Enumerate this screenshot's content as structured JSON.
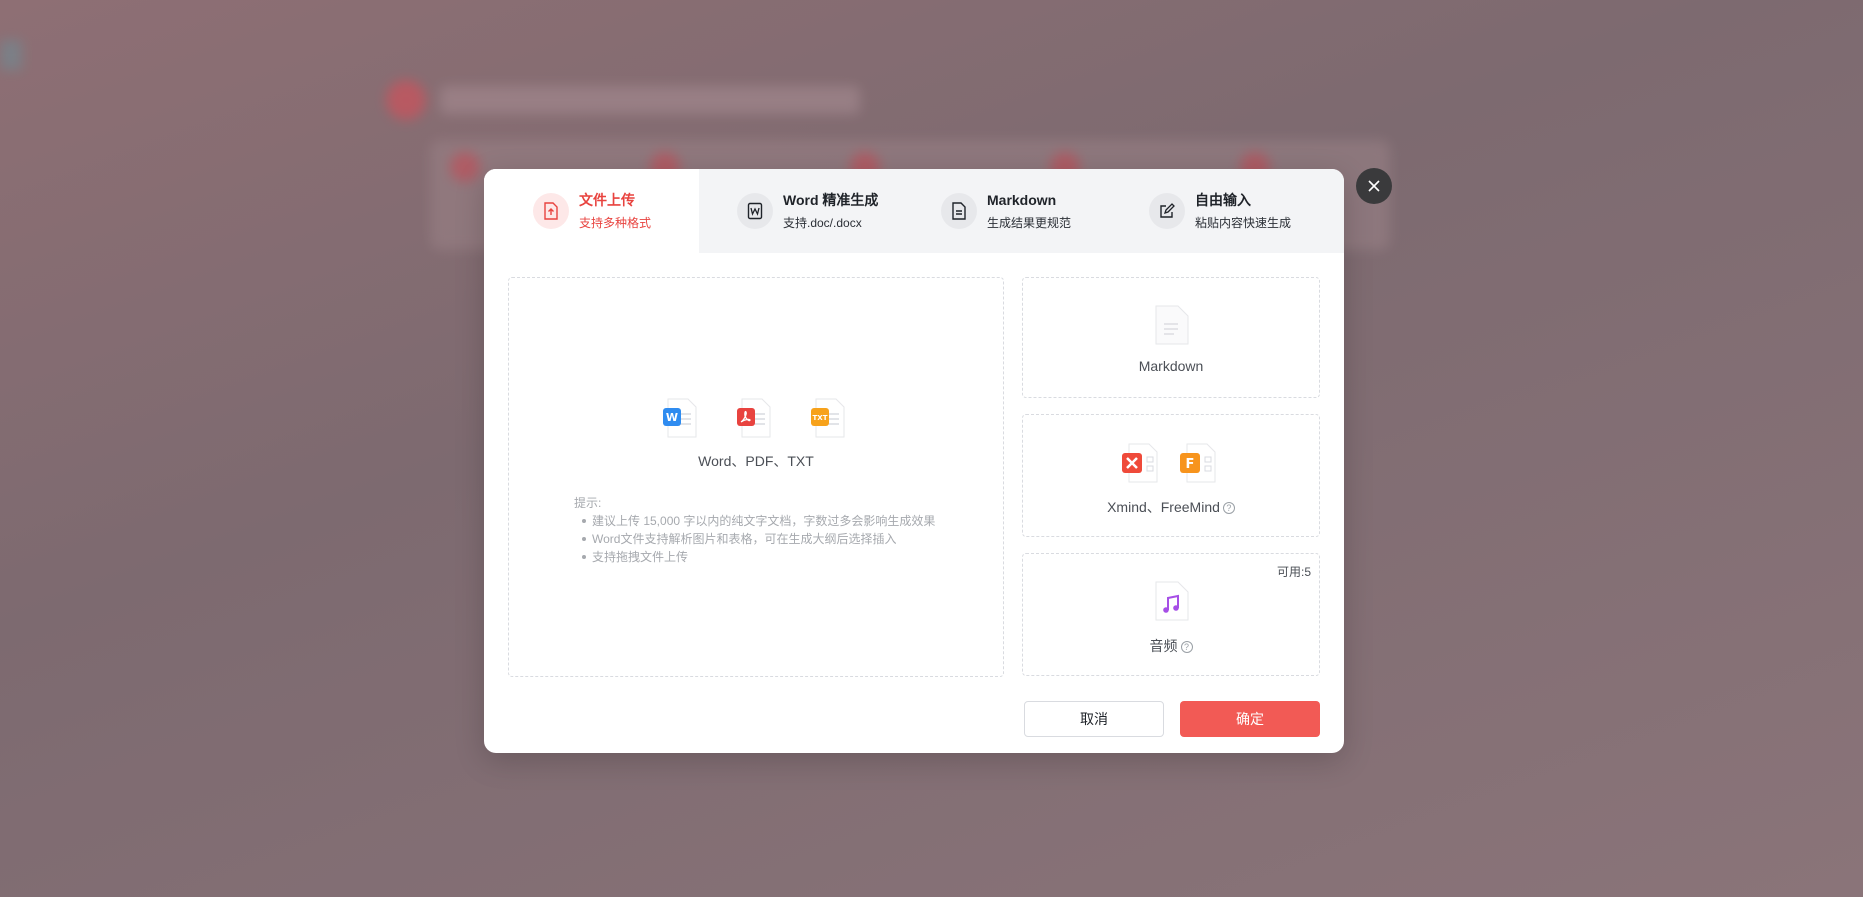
{
  "tabs": [
    {
      "title": "文件上传",
      "subtitle": "支持多种格式",
      "icon": "upload-file-icon",
      "active": true
    },
    {
      "title": "Word 精准生成",
      "subtitle": "支持.doc/.docx",
      "icon": "word-doc-icon",
      "active": false
    },
    {
      "title": "Markdown",
      "subtitle": "生成结果更规范",
      "icon": "document-lines-icon",
      "active": false
    },
    {
      "title": "自由输入",
      "subtitle": "粘贴内容快速生成",
      "icon": "edit-icon",
      "active": false
    }
  ],
  "upload": {
    "icons": [
      {
        "name": "word-file-icon",
        "badge": "W",
        "color": "#2f8cf0"
      },
      {
        "name": "pdf-file-icon",
        "badge": "PDF",
        "color": "#e8433f"
      },
      {
        "name": "txt-file-icon",
        "badge": "TXT",
        "color": "#f7a21b"
      }
    ],
    "formats": "Word、PDF、TXT",
    "tips_title": "提示:",
    "tips": [
      "建议上传 15,000 字以内的纯文字文档，字数过多会影响生成效果",
      "Word文件支持解析图片和表格，可在生成大纲后选择插入",
      "支持拖拽文件上传"
    ]
  },
  "cards": {
    "markdown": {
      "label": "Markdown"
    },
    "mindmap": {
      "label": "Xmind、FreeMind",
      "help": "?"
    },
    "audio": {
      "label": "音频",
      "help": "?",
      "available": "可用:5"
    }
  },
  "buttons": {
    "cancel": "取消",
    "confirm": "确定"
  },
  "colors": {
    "accent": "#f25a55",
    "active_text": "#e8433f",
    "close_bg": "#3a3a3c"
  }
}
